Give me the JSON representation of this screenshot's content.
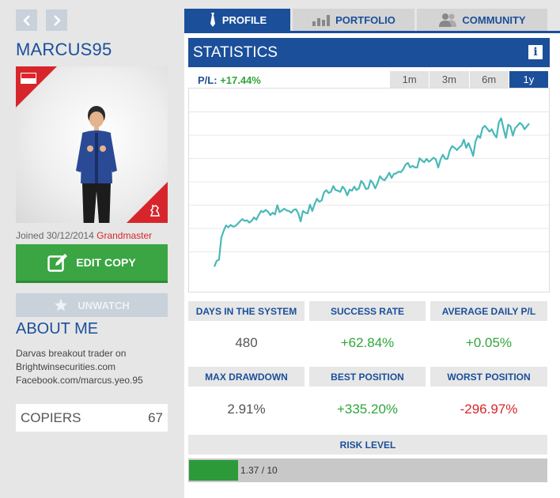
{
  "sidebar": {
    "username": "MARCUS95",
    "joined_label": "Joined 30/12/2014",
    "grade": "Grandmaster",
    "edit_copy_label": "EDIT COPY",
    "unwatch_label": "UNWATCH",
    "about_title": "ABOUT ME",
    "about_lines": [
      "Darvas breakout trader on",
      "Brightwinsecurities.com",
      "Facebook.com/marcus.yeo.95"
    ],
    "copiers_label": "COPIERS",
    "copiers_count": "67"
  },
  "tabs": [
    {
      "label": "PROFILE",
      "icon": "tie-icon",
      "active": true
    },
    {
      "label": "PORTFOLIO",
      "icon": "bar-chart-icon",
      "active": false
    },
    {
      "label": "COMMUNITY",
      "icon": "people-icon",
      "active": false
    }
  ],
  "statistics": {
    "title": "STATISTICS",
    "info_icon": "i",
    "pl_label": "P/L:",
    "pl_value": "+17.44%",
    "ranges": [
      "1m",
      "3m",
      "6m",
      "1y"
    ],
    "active_range": "1y"
  },
  "metrics": [
    {
      "label": "DAYS IN THE SYSTEM",
      "value": "480",
      "tone": "neutral"
    },
    {
      "label": "SUCCESS RATE",
      "value": "+62.84%",
      "tone": "pos"
    },
    {
      "label": "AVERAGE DAILY P/L",
      "value": "+0.05%",
      "tone": "pos"
    },
    {
      "label": "MAX DRAWDOWN",
      "value": "2.91%",
      "tone": "neutral"
    },
    {
      "label": "BEST POSITION",
      "value": "+335.20%",
      "tone": "pos"
    },
    {
      "label": "WORST POSITION",
      "value": "-296.97%",
      "tone": "neg"
    }
  ],
  "risk": {
    "label": "RISK LEVEL",
    "value_text": "1.37 / 10",
    "level": 1.37,
    "max": 10
  },
  "colors": {
    "brand_blue": "#1b4f9a",
    "positive_green": "#2fa63a",
    "negative_red": "#d7262b",
    "line_teal": "#4ab8b8"
  },
  "chart_data": {
    "type": "line",
    "series": [
      {
        "values": [
          2,
          3,
          3.2,
          7,
          8.2,
          9.1,
          8.8,
          9.2,
          8.9,
          9,
          9.4,
          9.8,
          10.2,
          9.9,
          10,
          9.6,
          9.9,
          10.5,
          10.1,
          10.9,
          11.6,
          11.4,
          11.8,
          11.5,
          10.9,
          11.3,
          11,
          12.6,
          11.4,
          11.7,
          12,
          11.7,
          11.6,
          11.3,
          11.8,
          11.9,
          11.2,
          9.8,
          11.6,
          11.3,
          11.2,
          12.7,
          11.6,
          12.8,
          13.7,
          13.2,
          13.4,
          14.8,
          15.2,
          14.7,
          14.9,
          15.9,
          15.2,
          15.1,
          14.9,
          15.8,
          15.3,
          14.3,
          15.3,
          15.1,
          15.8,
          15.2,
          15.5,
          16.8,
          16.3,
          15.4,
          15.5,
          16.9,
          16.4,
          15.5,
          16.4,
          17.6,
          17.1,
          16.9,
          17.5,
          18.2,
          17.3,
          18,
          18.1,
          18.4,
          18.3,
          18.8,
          19.6,
          19.9,
          19.1,
          19.4,
          19.1,
          19.1,
          20.7,
          20.3,
          20,
          20.6,
          20.1,
          20.4,
          20.8,
          20.5,
          19.1,
          20.5,
          21.3,
          20.6,
          20.6,
          22.1,
          22.8,
          22.5,
          22.1,
          22.6,
          22.9,
          23.9,
          22.5,
          23.3,
          22.3,
          21.1,
          23.6,
          24.6,
          24.2,
          25.9,
          26.3,
          25.8,
          25.3,
          25.7,
          24.8,
          24.3,
          26.9,
          27.6,
          25.8,
          24.2,
          26.5,
          26.2,
          24.6,
          25.9,
          26.3,
          26.8,
          26.5,
          25.7,
          26.2,
          26.7
        ]
      }
    ]
  }
}
